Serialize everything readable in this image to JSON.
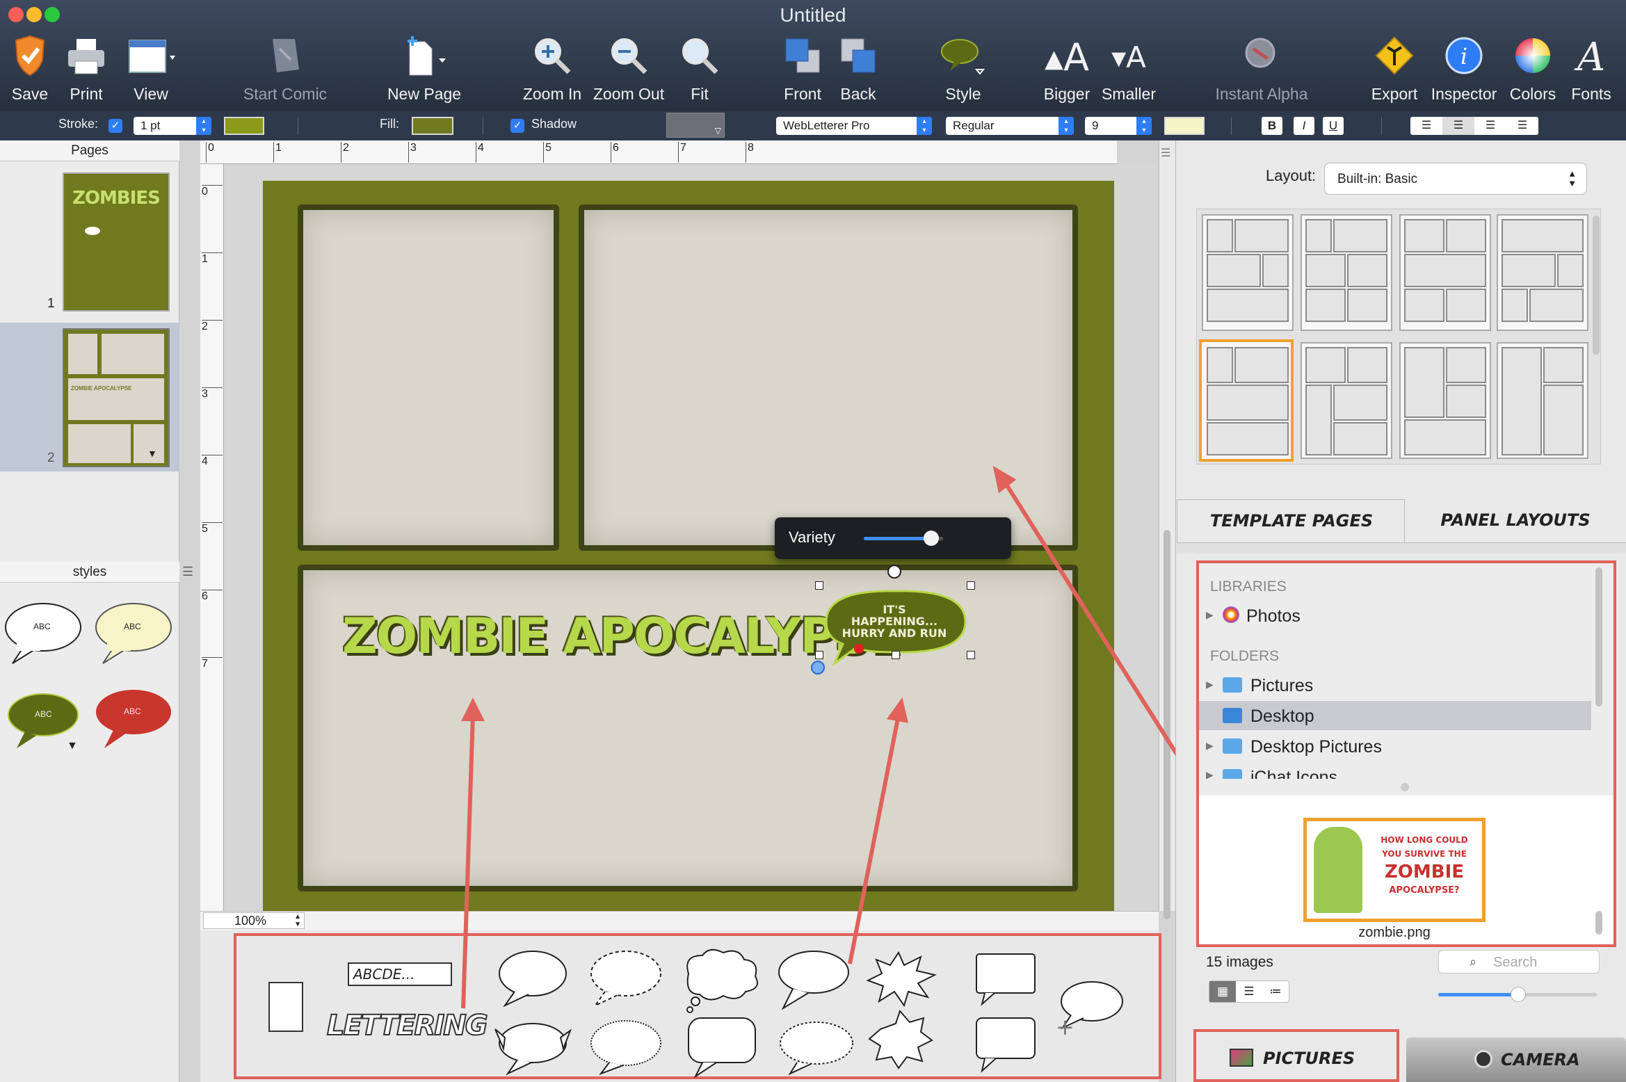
{
  "window": {
    "title": "Untitled"
  },
  "toolbar": {
    "items": [
      {
        "label": "Save",
        "icon": "shield-check-icon",
        "enabled": true
      },
      {
        "label": "Print",
        "icon": "printer-icon",
        "enabled": true
      },
      {
        "label": "View",
        "icon": "view-icon",
        "enabled": true
      },
      {
        "label": "Start Comic",
        "icon": "start-comic-icon",
        "enabled": false
      },
      {
        "label": "New Page",
        "icon": "new-page-icon",
        "enabled": true
      },
      {
        "label": "Zoom In",
        "icon": "zoom-in-icon",
        "enabled": true
      },
      {
        "label": "Zoom Out",
        "icon": "zoom-out-icon",
        "enabled": true
      },
      {
        "label": "Fit",
        "icon": "fit-icon",
        "enabled": true
      },
      {
        "label": "Front",
        "icon": "front-icon",
        "enabled": true
      },
      {
        "label": "Back",
        "icon": "back-icon",
        "enabled": true
      },
      {
        "label": "Style",
        "icon": "style-bubble-icon",
        "enabled": true
      },
      {
        "label": "Bigger",
        "icon": "bigger-font-icon",
        "enabled": true
      },
      {
        "label": "Smaller",
        "icon": "smaller-font-icon",
        "enabled": true
      },
      {
        "label": "Instant Alpha",
        "icon": "instant-alpha-icon",
        "enabled": false
      },
      {
        "label": "Export",
        "icon": "export-icon",
        "enabled": true
      },
      {
        "label": "Inspector",
        "icon": "inspector-icon",
        "enabled": true
      },
      {
        "label": "Colors",
        "icon": "colors-icon",
        "enabled": true
      },
      {
        "label": "Fonts",
        "icon": "fonts-icon",
        "enabled": true
      }
    ]
  },
  "formatbar": {
    "stroke_label": "Stroke:",
    "stroke_width": "1 pt",
    "fill_label": "Fill:",
    "shadow_label": "Shadow",
    "font_name": "WebLetterer Pro",
    "font_style": "Regular",
    "font_size": "9",
    "bold": "B",
    "italic": "I",
    "underline": "U",
    "stroke_color": "#8a9a1a",
    "fill_color": "#6f7a1e",
    "text_color": "#f4f4c8"
  },
  "pages": {
    "header": "Pages",
    "items": [
      {
        "number": "1",
        "cover_title": "ZOMBIES"
      },
      {
        "number": "2",
        "title": "ZOMBIE APOCALYPSE"
      }
    ]
  },
  "styles": {
    "header": "styles",
    "items": [
      {
        "text": "ABC",
        "color": "#ffffff"
      },
      {
        "text": "ABC",
        "color": "#f8f4c8"
      },
      {
        "text": "ABC",
        "color": "#5c6a14"
      },
      {
        "text": "ABC",
        "color": "#c8362e"
      }
    ]
  },
  "ruler": {
    "top": [
      "0",
      "1",
      "2",
      "3",
      "4",
      "5",
      "6",
      "7",
      "8"
    ],
    "left": [
      "0",
      "1",
      "2",
      "3",
      "4",
      "5",
      "6",
      "7"
    ]
  },
  "canvas": {
    "title_text": "ZOMBIE APOCALYPSE",
    "bubble_text": "IT'S HAPPENING... HURRY AND RUN",
    "variety_label": "Variety",
    "variety_value": 0.85,
    "zoom": "100%"
  },
  "balloons": {
    "caption_text": "ABCDE...",
    "lettering_text": "LETTERING"
  },
  "rightpanel": {
    "layout_label": "Layout:",
    "layout_value": "Built-in: Basic",
    "tab_template": "TEMPLATE PAGES",
    "tab_panels": "PANEL LAYOUTS",
    "libraries_header": "LIBRARIES",
    "photos": "Photos",
    "folders_header": "FOLDERS",
    "folders": [
      "Pictures",
      "Desktop",
      "Desktop Pictures",
      "iChat Icons"
    ],
    "selected_folder": "Desktop",
    "image_name": "zombie.png",
    "image_caption_lines": [
      "HOW LONG COULD",
      "YOU SURVIVE THE",
      "ZOMBIE",
      "APOCALYPSE?"
    ],
    "image_count": "15 images",
    "search_placeholder": "Search",
    "bottom_tab_pictures": "PICTURES",
    "bottom_tab_camera": "CAMERA"
  }
}
